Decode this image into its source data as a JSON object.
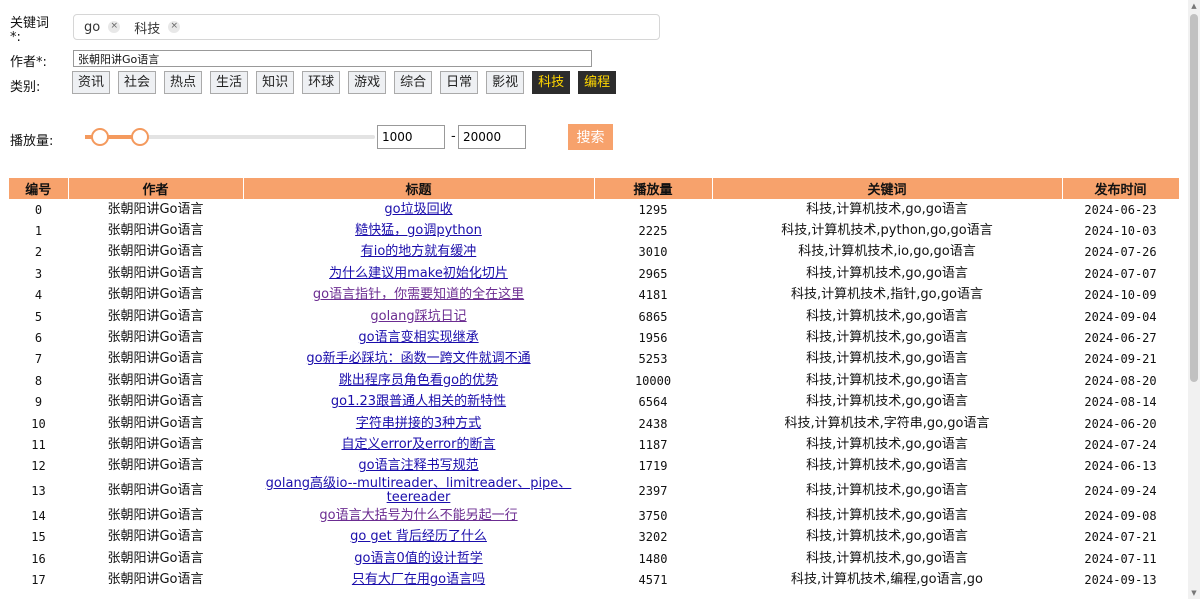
{
  "form": {
    "keywords_label": "关键词",
    "keywords_required": "*:",
    "keywords": [
      "go",
      "科技"
    ],
    "remove_symbol": "×",
    "author_label": "作者*:",
    "author_value": "张朝阳讲Go语言",
    "category_label": "类别:",
    "categories": [
      {
        "label": "资讯",
        "active": false
      },
      {
        "label": "社会",
        "active": false
      },
      {
        "label": "热点",
        "active": false
      },
      {
        "label": "生活",
        "active": false
      },
      {
        "label": "知识",
        "active": false
      },
      {
        "label": "环球",
        "active": false
      },
      {
        "label": "游戏",
        "active": false
      },
      {
        "label": "综合",
        "active": false
      },
      {
        "label": "日常",
        "active": false
      },
      {
        "label": "影视",
        "active": false
      },
      {
        "label": "科技",
        "active": true
      },
      {
        "label": "编程",
        "active": true
      }
    ],
    "play_label": "播放量:",
    "slider_low_fraction": 0.05,
    "slider_high_fraction": 0.19,
    "min_value": "1000",
    "dash": "-",
    "max_value": "20000",
    "search_label": "搜索"
  },
  "table": {
    "headers": [
      "编号",
      "作者",
      "标题",
      "播放量",
      "关键词",
      "发布时间"
    ],
    "rows": [
      {
        "id": "0",
        "author": "张朝阳讲Go语言",
        "title": "go垃圾回收",
        "visited": false,
        "plays": "1295",
        "keywords": "科技,计算机技术,go,go语言",
        "date": "2024-06-23"
      },
      {
        "id": "1",
        "author": "张朝阳讲Go语言",
        "title": "糙快猛，go调python",
        "visited": false,
        "plays": "2225",
        "keywords": "科技,计算机技术,python,go,go语言",
        "date": "2024-10-03"
      },
      {
        "id": "2",
        "author": "张朝阳讲Go语言",
        "title": "有io的地方就有缓冲",
        "visited": false,
        "plays": "3010",
        "keywords": "科技,计算机技术,io,go,go语言",
        "date": "2024-07-26"
      },
      {
        "id": "3",
        "author": "张朝阳讲Go语言",
        "title": "为什么建议用make初始化切片",
        "visited": false,
        "plays": "2965",
        "keywords": "科技,计算机技术,go,go语言",
        "date": "2024-07-07"
      },
      {
        "id": "4",
        "author": "张朝阳讲Go语言",
        "title": "go语言指针，你需要知道的全在这里",
        "visited": true,
        "plays": "4181",
        "keywords": "科技,计算机技术,指针,go,go语言",
        "date": "2024-10-09"
      },
      {
        "id": "5",
        "author": "张朝阳讲Go语言",
        "title": "golang踩坑日记",
        "visited": true,
        "plays": "6865",
        "keywords": "科技,计算机技术,go,go语言",
        "date": "2024-09-04"
      },
      {
        "id": "6",
        "author": "张朝阳讲Go语言",
        "title": "go语言变相实现继承",
        "visited": false,
        "plays": "1956",
        "keywords": "科技,计算机技术,go,go语言",
        "date": "2024-06-27"
      },
      {
        "id": "7",
        "author": "张朝阳讲Go语言",
        "title": "go新手必踩坑：函数一跨文件就调不通",
        "visited": false,
        "plays": "5253",
        "keywords": "科技,计算机技术,go,go语言",
        "date": "2024-09-21"
      },
      {
        "id": "8",
        "author": "张朝阳讲Go语言",
        "title": "跳出程序员角色看go的优势",
        "visited": false,
        "plays": "10000",
        "keywords": "科技,计算机技术,go,go语言",
        "date": "2024-08-20"
      },
      {
        "id": "9",
        "author": "张朝阳讲Go语言",
        "title": "go1.23跟普通人相关的新特性",
        "visited": false,
        "plays": "6564",
        "keywords": "科技,计算机技术,go,go语言",
        "date": "2024-08-14"
      },
      {
        "id": "10",
        "author": "张朝阳讲Go语言",
        "title": "字符串拼接的3种方式",
        "visited": false,
        "plays": "2438",
        "keywords": "科技,计算机技术,字符串,go,go语言",
        "date": "2024-06-20"
      },
      {
        "id": "11",
        "author": "张朝阳讲Go语言",
        "title": "自定义error及error的断言",
        "visited": false,
        "plays": "1187",
        "keywords": "科技,计算机技术,go,go语言",
        "date": "2024-07-24"
      },
      {
        "id": "12",
        "author": "张朝阳讲Go语言",
        "title": "go语言注释书写规范",
        "visited": false,
        "plays": "1719",
        "keywords": "科技,计算机技术,go,go语言",
        "date": "2024-06-13"
      },
      {
        "id": "13",
        "author": "张朝阳讲Go语言",
        "title": "golang高级io--multireader、limitreader、pipe、teereader",
        "visited": false,
        "plays": "2397",
        "keywords": "科技,计算机技术,go,go语言",
        "date": "2024-09-24"
      },
      {
        "id": "14",
        "author": "张朝阳讲Go语言",
        "title": "go语言大括号为什么不能另起一行",
        "visited": true,
        "plays": "3750",
        "keywords": "科技,计算机技术,go,go语言",
        "date": "2024-09-08"
      },
      {
        "id": "15",
        "author": "张朝阳讲Go语言",
        "title": "go get 背后经历了什么",
        "visited": false,
        "plays": "3202",
        "keywords": "科技,计算机技术,go,go语言",
        "date": "2024-07-21"
      },
      {
        "id": "16",
        "author": "张朝阳讲Go语言",
        "title": "go语言0值的设计哲学",
        "visited": false,
        "plays": "1480",
        "keywords": "科技,计算机技术,go,go语言",
        "date": "2024-07-11"
      },
      {
        "id": "17",
        "author": "张朝阳讲Go语言",
        "title": "只有大厂在用go语言吗",
        "visited": false,
        "plays": "4571",
        "keywords": "科技,计算机技术,编程,go语言,go",
        "date": "2024-09-13"
      }
    ]
  }
}
